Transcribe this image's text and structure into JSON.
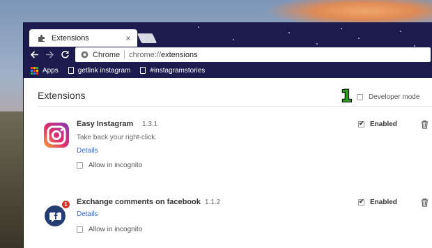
{
  "tab": {
    "title": "Extensions",
    "close": "×"
  },
  "omnibox": {
    "chip": "Chrome",
    "url_scheme": "chrome://",
    "url_path": "extensions"
  },
  "bookmarks": [
    {
      "label": "Apps"
    },
    {
      "label": "getlink instagram"
    },
    {
      "label": "#instagramstories"
    }
  ],
  "page": {
    "title": "Extensions",
    "developer_mode": {
      "label": "Developer mode",
      "checked": false
    },
    "annotation": "1"
  },
  "extensions": [
    {
      "name": "Easy Instagram",
      "version": "1.3.1",
      "description": "Take back your right-click.",
      "details": "Details",
      "incognito": "Allow in incognito",
      "enabled_label": "Enabled",
      "enabled": true
    },
    {
      "name": "Exchange comments on facebook",
      "version": "1.1.2",
      "details": "Details",
      "incognito": "Allow in incognito",
      "enabled_label": "Enabled",
      "enabled": true,
      "badge": "1"
    }
  ],
  "colors": {
    "accent_link": "#3367d6",
    "annotation": "#2d9b1f",
    "window_frame": "#1d1a4d"
  }
}
